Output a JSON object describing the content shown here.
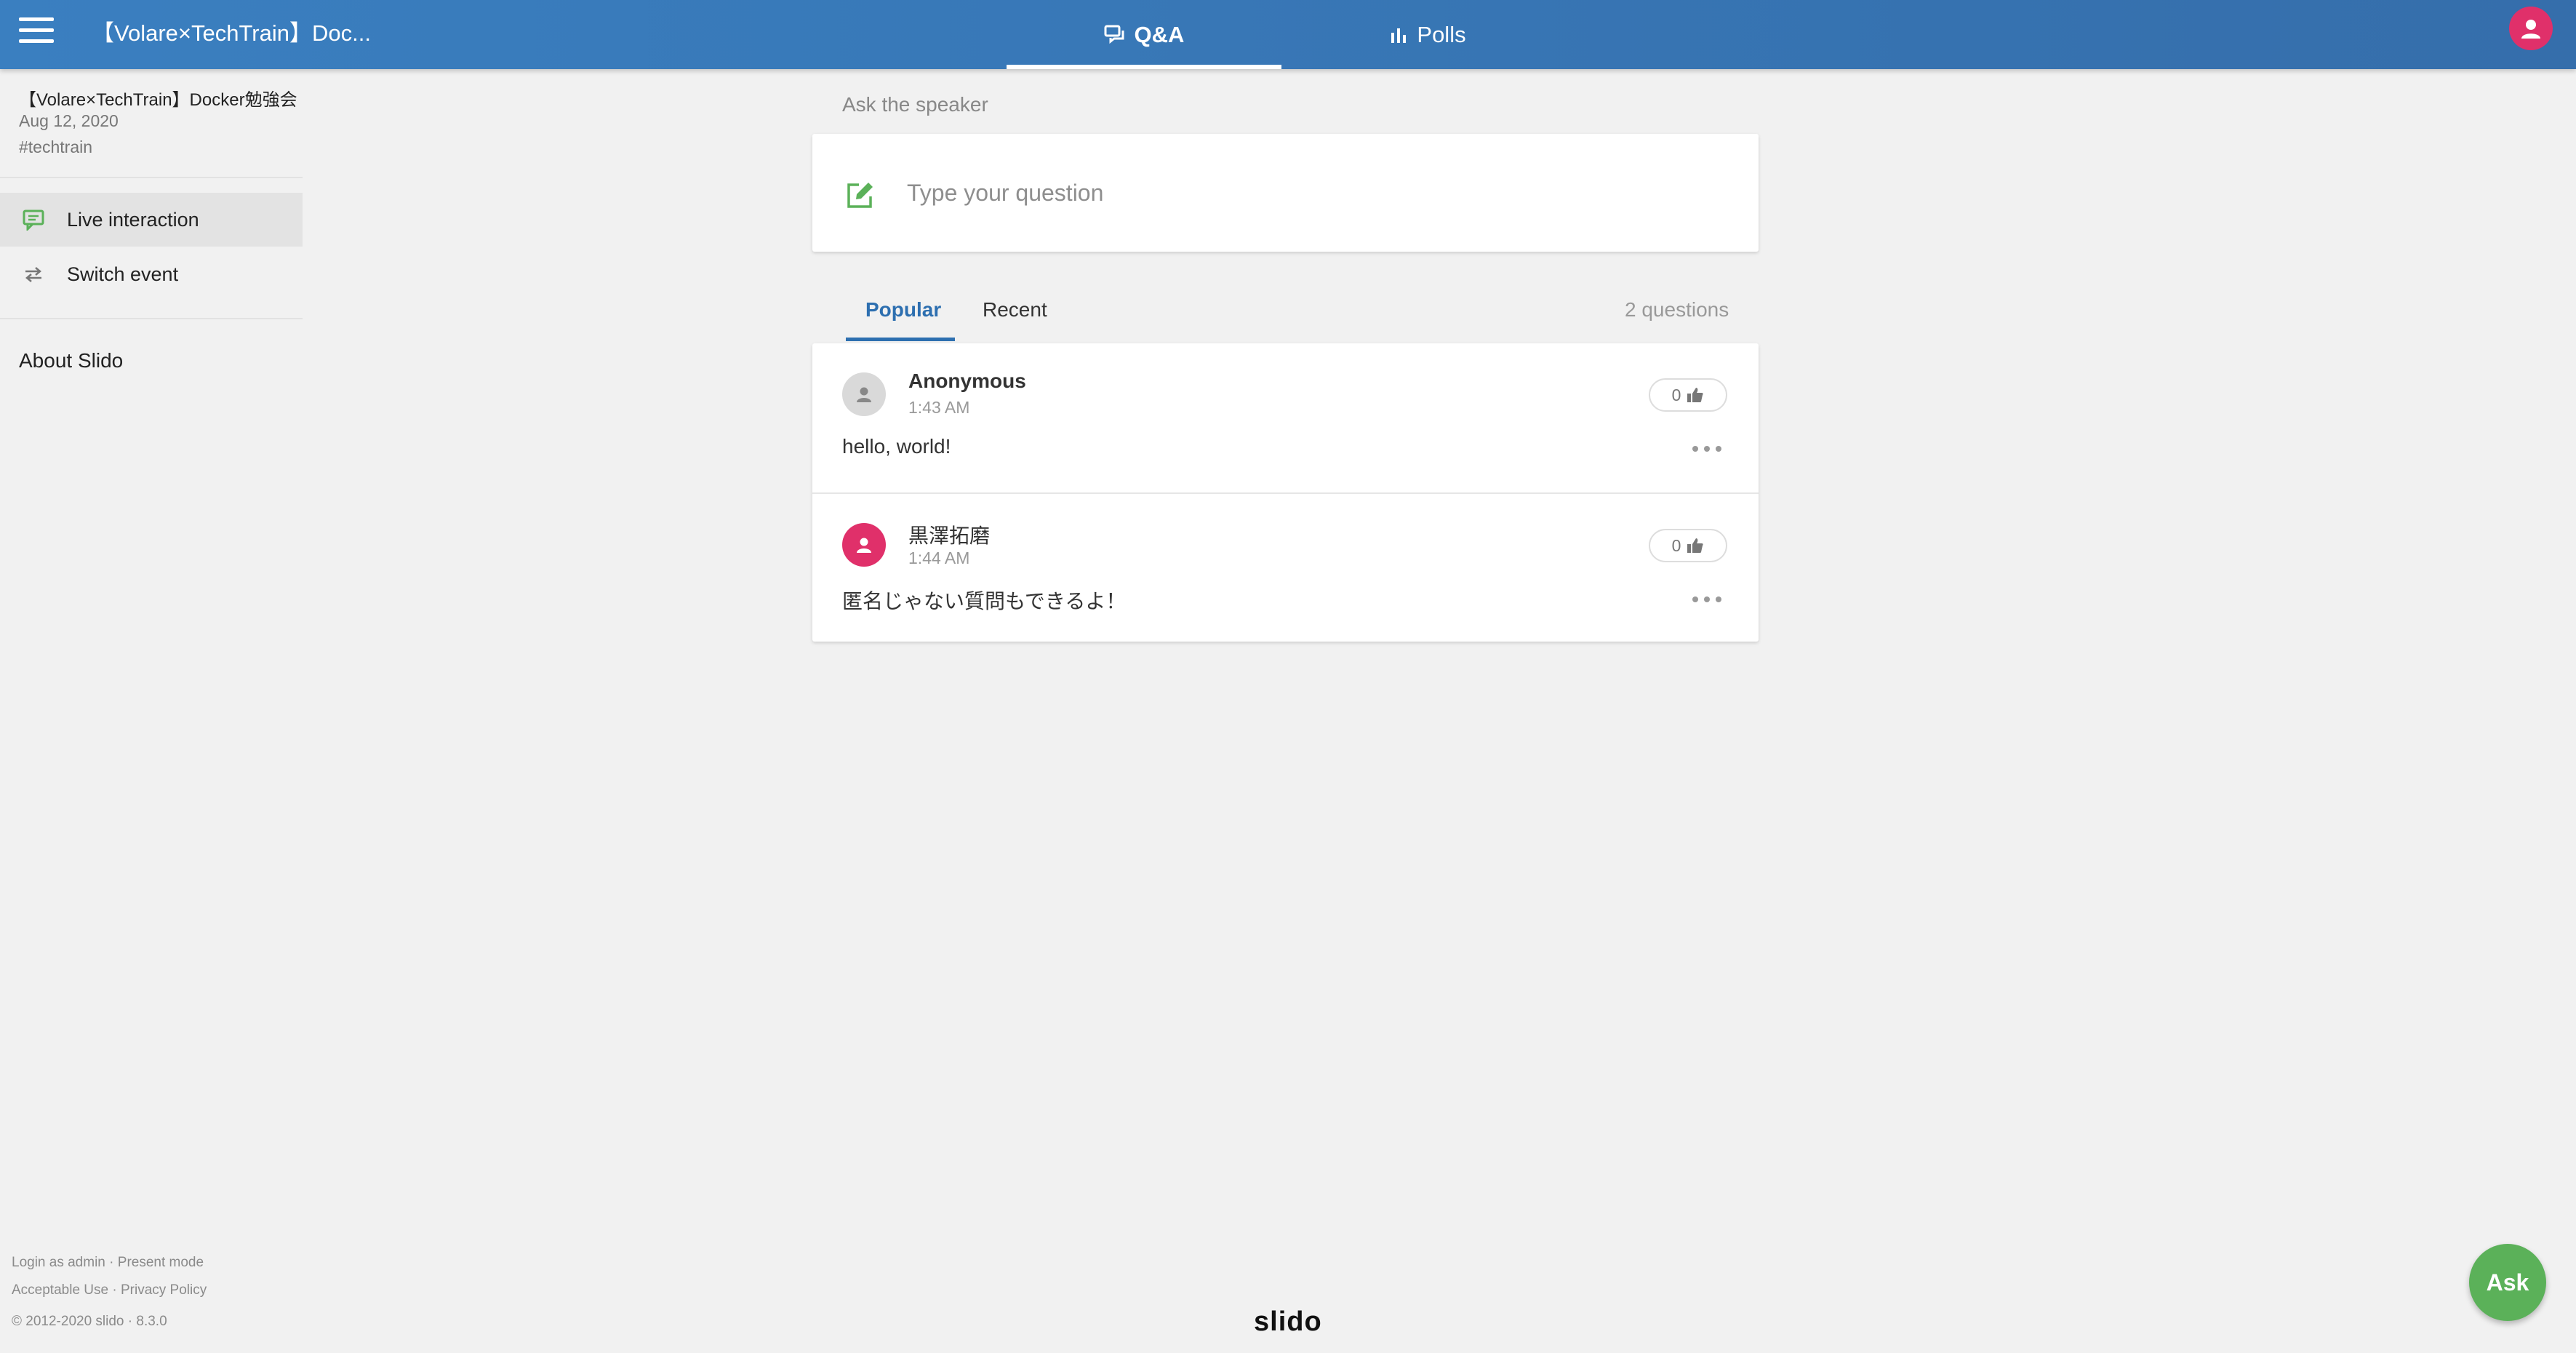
{
  "header": {
    "event_title": "【Volare×TechTrain】Doc...",
    "tabs": [
      {
        "label": "Q&A",
        "icon": "chat-bubbles-icon",
        "active": true
      },
      {
        "label": "Polls",
        "icon": "bar-chart-icon",
        "active": false
      }
    ]
  },
  "sidebar": {
    "event_name": "【Volare×TechTrain】Docker勉強会",
    "event_date": "Aug 12, 2020",
    "event_code": "#techtrain",
    "items": [
      {
        "label": "Live interaction",
        "icon": "live-interaction-icon",
        "active": true
      },
      {
        "label": "Switch event",
        "icon": "swap-arrows-icon",
        "active": false
      }
    ],
    "about": "About Slido",
    "footer": {
      "login_admin": "Login as admin",
      "present_mode": "Present mode",
      "acceptable_use": "Acceptable Use",
      "privacy_policy": "Privacy Policy",
      "copyright": "© 2012-2020 slido · 8.3.0",
      "separator": "·"
    }
  },
  "qa": {
    "ask_label": "Ask the speaker",
    "input_placeholder": "Type your question",
    "sort_tabs": [
      "Popular",
      "Recent"
    ],
    "active_sort": "Popular",
    "count_text": "2 questions",
    "questions": [
      {
        "author": "Anonymous",
        "time": "1:43 AM",
        "text": "hello, world!",
        "likes": "0",
        "avatar_color": "#d9d9d9"
      },
      {
        "author": "黒澤拓磨",
        "time": "1:44 AM",
        "text": "匿名じゃない質問もできるよ！",
        "likes": "0",
        "avatar_color": "#e0306a"
      }
    ]
  },
  "brand": {
    "logo": "slido"
  },
  "fab": {
    "label": "Ask"
  },
  "colors": {
    "topbar": "#3a7fc0",
    "accent_blue": "#2d6fb0",
    "green": "#5bb159",
    "pink": "#e0306a"
  }
}
